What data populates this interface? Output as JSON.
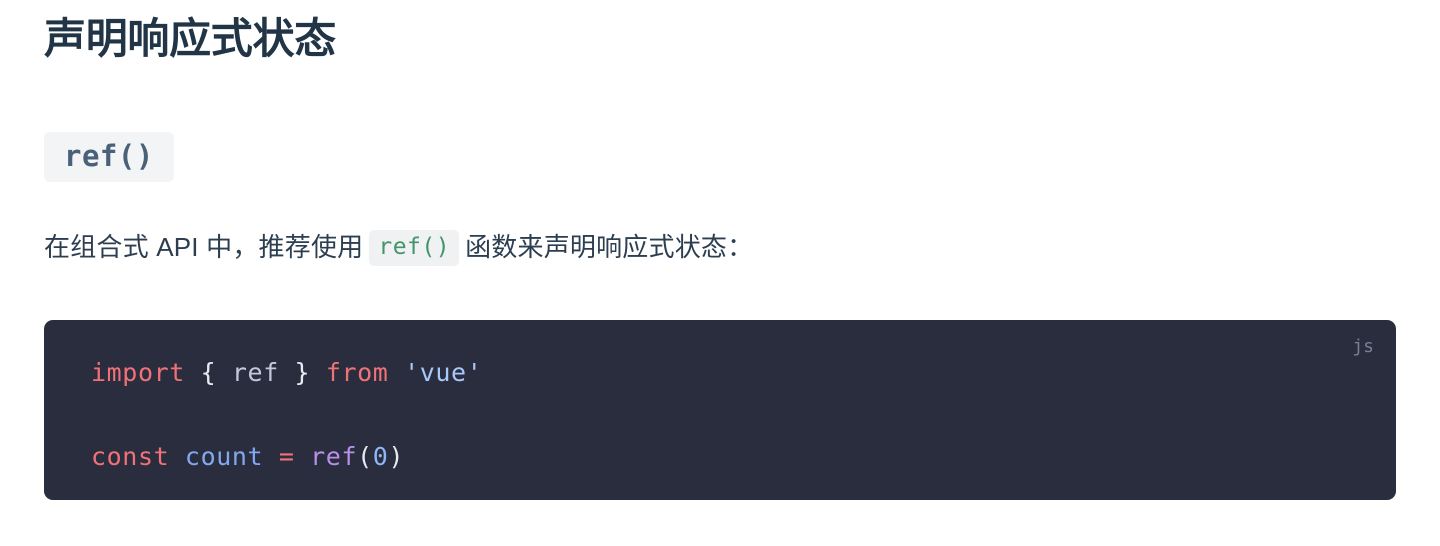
{
  "page": {
    "title": "声明响应式状态"
  },
  "section": {
    "heading_code": "ref()"
  },
  "paragraph": {
    "lead": "在组合式 API 中，推荐使用",
    "inline_code": "ref()",
    "trail": "函数来声明响应式状态："
  },
  "code_block": {
    "language_label": "js",
    "background": "#292d3e",
    "lines": [
      {
        "tokens": [
          {
            "text": "import",
            "type": "keyword"
          },
          {
            "text": " ",
            "type": "plain"
          },
          {
            "text": "{",
            "type": "punct"
          },
          {
            "text": " ",
            "type": "plain"
          },
          {
            "text": "ref",
            "type": "plain"
          },
          {
            "text": " ",
            "type": "plain"
          },
          {
            "text": "}",
            "type": "punct"
          },
          {
            "text": " ",
            "type": "plain"
          },
          {
            "text": "from",
            "type": "keyword"
          },
          {
            "text": " ",
            "type": "plain"
          },
          {
            "text": "'vue'",
            "type": "string"
          }
        ]
      },
      {
        "tokens": []
      },
      {
        "tokens": [
          {
            "text": "const",
            "type": "keyword"
          },
          {
            "text": " ",
            "type": "plain"
          },
          {
            "text": "count",
            "type": "variable"
          },
          {
            "text": " ",
            "type": "plain"
          },
          {
            "text": "=",
            "type": "operator"
          },
          {
            "text": " ",
            "type": "plain"
          },
          {
            "text": "ref",
            "type": "func"
          },
          {
            "text": "(",
            "type": "punct"
          },
          {
            "text": "0",
            "type": "number"
          },
          {
            "text": ")",
            "type": "punct"
          }
        ]
      }
    ]
  },
  "colors": {
    "title": "#213547",
    "body_text": "#2c3e50",
    "heading_code_text": "#4a6279",
    "heading_code_bg": "#f3f4f5",
    "inline_code_text": "#43946a",
    "inline_code_bg": "#f0f1f2",
    "code_bg": "#292d3e",
    "code_lang_label": "#7a7f93",
    "keyword": "#f07178",
    "string": "#a8c7fa",
    "variable": "#84a8f0",
    "function": "#b98fe8",
    "number": "#8fb6f5",
    "punctuation": "#e8eaf2"
  }
}
